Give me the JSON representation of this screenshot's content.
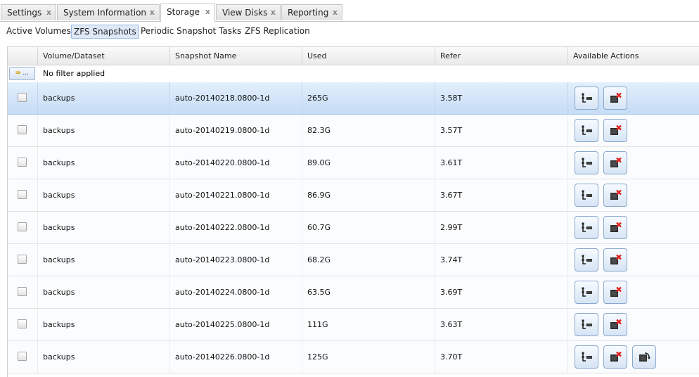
{
  "tabs": [
    {
      "label": "Settings",
      "close": "x"
    },
    {
      "label": "System Information",
      "close": "x"
    },
    {
      "label": "Storage",
      "close": "x"
    },
    {
      "label": "View Disks",
      "close": "x"
    },
    {
      "label": "Reporting",
      "close": "x"
    }
  ],
  "active_tab": "Storage",
  "subtabs": [
    "Active Volumes",
    "ZFS Snapshots",
    "Periodic Snapshot Tasks",
    "ZFS Replication"
  ],
  "active_subtab": "ZFS Snapshots",
  "grid": {
    "columns": [
      "Volume/Dataset",
      "Snapshot Name",
      "Used",
      "Refer",
      "Available Actions"
    ],
    "filter_button": "...",
    "filter_text": "No filter applied",
    "rows": [
      {
        "volume": "backups",
        "snapshot": "auto-20140218.0800-1d",
        "used": "265G",
        "refer": "3.58T",
        "selected": true,
        "actions": [
          "clone-icon",
          "delete-icon"
        ]
      },
      {
        "volume": "backups",
        "snapshot": "auto-20140219.0800-1d",
        "used": "82.3G",
        "refer": "3.57T",
        "selected": false,
        "actions": [
          "clone-icon",
          "delete-icon"
        ]
      },
      {
        "volume": "backups",
        "snapshot": "auto-20140220.0800-1d",
        "used": "89.0G",
        "refer": "3.61T",
        "selected": false,
        "actions": [
          "clone-icon",
          "delete-icon"
        ]
      },
      {
        "volume": "backups",
        "snapshot": "auto-20140221.0800-1d",
        "used": "86.9G",
        "refer": "3.67T",
        "selected": false,
        "actions": [
          "clone-icon",
          "delete-icon"
        ]
      },
      {
        "volume": "backups",
        "snapshot": "auto-20140222.0800-1d",
        "used": "60.7G",
        "refer": "2.99T",
        "selected": false,
        "actions": [
          "clone-icon",
          "delete-icon"
        ]
      },
      {
        "volume": "backups",
        "snapshot": "auto-20140223.0800-1d",
        "used": "68.2G",
        "refer": "3.74T",
        "selected": false,
        "actions": [
          "clone-icon",
          "delete-icon"
        ]
      },
      {
        "volume": "backups",
        "snapshot": "auto-20140224.0800-1d",
        "used": "63.5G",
        "refer": "3.69T",
        "selected": false,
        "actions": [
          "clone-icon",
          "delete-icon"
        ]
      },
      {
        "volume": "backups",
        "snapshot": "auto-20140225.0800-1d",
        "used": "111G",
        "refer": "3.63T",
        "selected": false,
        "actions": [
          "clone-icon",
          "delete-icon"
        ]
      },
      {
        "volume": "backups",
        "snapshot": "auto-20140226.0800-1d",
        "used": "125G",
        "refer": "3.70T",
        "selected": false,
        "actions": [
          "clone-icon",
          "delete-icon",
          "rollback-icon"
        ]
      }
    ]
  },
  "colors": {
    "selected_row": "#c6dcf5",
    "button_border": "#8aa6cc",
    "delete_mark": "#e0201b"
  }
}
